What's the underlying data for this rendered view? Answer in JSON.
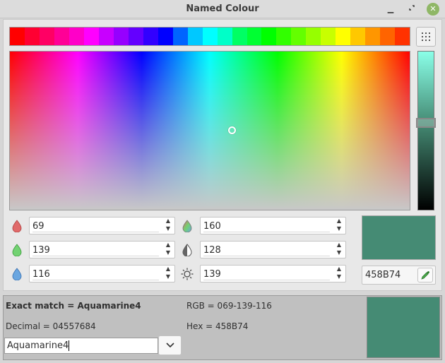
{
  "window": {
    "title": "Named Colour"
  },
  "palette_strip": [
    "#ff0000",
    "#ff0032",
    "#ff0064",
    "#ff0096",
    "#ff00c8",
    "#ff00ff",
    "#c800ff",
    "#9600ff",
    "#6400ff",
    "#3200ff",
    "#0000ff",
    "#0064ff",
    "#00c8ff",
    "#00ffff",
    "#00ffc8",
    "#00ff64",
    "#00ff32",
    "#00ff00",
    "#32ff00",
    "#64ff00",
    "#96ff00",
    "#c8ff00",
    "#ffff00",
    "#ffc800",
    "#ff9600",
    "#ff6400",
    "#ff3200"
  ],
  "fields": {
    "red": "69",
    "green": "139",
    "blue": "116",
    "hue": "160",
    "saturation": "128",
    "value": "139"
  },
  "hex_value": "458B74",
  "current_color": "#458b74",
  "colors": {
    "red_icon": "#e05a5a",
    "green_icon": "#5ac85a",
    "blue_icon": "#5a9ae0"
  },
  "match": {
    "title": "Exact match = Aquamarine4",
    "rgb": "RGB = 069-139-116",
    "decimal": "Decimal = 04557684",
    "hex": "Hex = 458B74",
    "name_value": "Aquamarine4"
  }
}
